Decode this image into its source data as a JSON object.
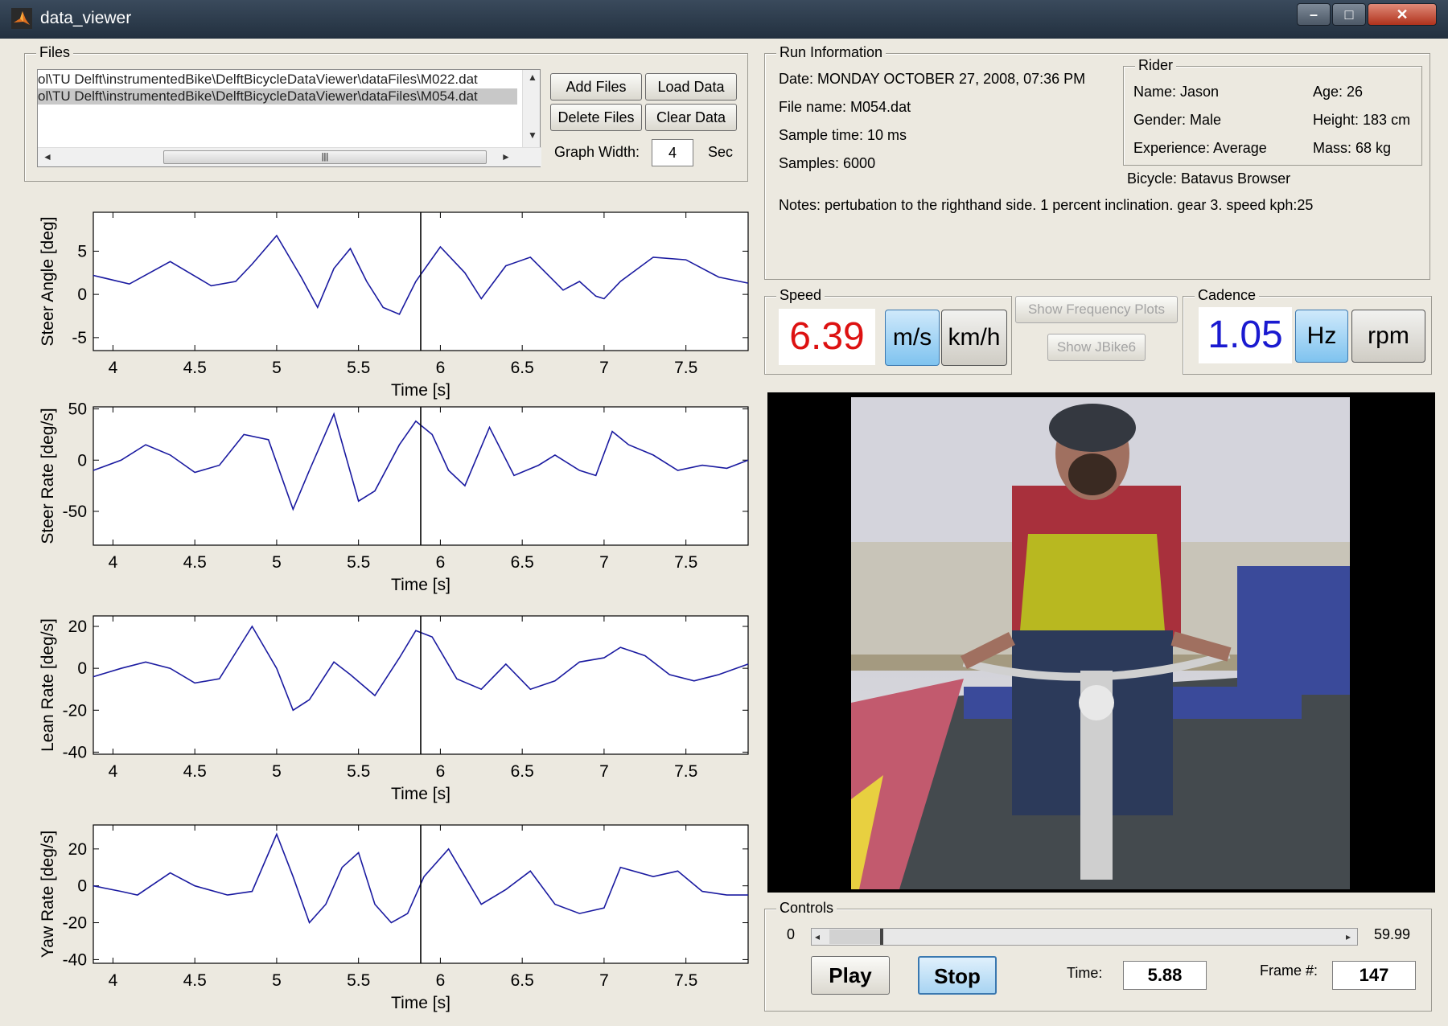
{
  "window": {
    "title": "data_viewer"
  },
  "files": {
    "group_label": "Files",
    "items": [
      "ol\\TU Delft\\instrumentedBike\\DelftBicycleDataViewer\\dataFiles\\M022.dat",
      "ol\\TU Delft\\instrumentedBike\\DelftBicycleDataViewer\\dataFiles\\M054.dat"
    ],
    "selected_index": 1,
    "add_label": "Add Files",
    "load_label": "Load Data",
    "delete_label": "Delete Files",
    "clear_label": "Clear Data",
    "graph_width_label": "Graph Width:",
    "graph_width_value": "4",
    "graph_width_unit": "Sec"
  },
  "run_info": {
    "group_label": "Run Information",
    "date": "Date: MONDAY OCTOBER 27, 2008, 07:36 PM",
    "file_name": "File name: M054.dat",
    "sample_time": "Sample time: 10 ms",
    "samples": "Samples: 6000",
    "notes": "Notes: pertubation to the righthand side.  1 percent inclination. gear 3.  speed kph:25",
    "bicycle": "Bicycle: Batavus Browser",
    "rider": {
      "group_label": "Rider",
      "name": "Name: Jason",
      "age": "Age: 26",
      "gender": "Gender: Male",
      "height": "Height: 183 cm",
      "experience": "Experience: Average",
      "mass": "Mass: 68 kg"
    }
  },
  "speed": {
    "group_label": "Speed",
    "value": "6.39",
    "unit_active": "m/s",
    "unit_other": "km/h",
    "value_color": "#dd1111"
  },
  "mid_buttons": {
    "freq": "Show Frequency Plots",
    "jbike": "Show JBike6"
  },
  "cadence": {
    "group_label": "Cadence",
    "value": "1.05",
    "unit_active": "Hz",
    "unit_other": "rpm",
    "value_color": "#1a1ad0"
  },
  "controls": {
    "group_label": "Controls",
    "slider_min": "0",
    "slider_max": "59.99",
    "slider_fraction": 0.098,
    "play_label": "Play",
    "stop_label": "Stop",
    "time_label": "Time:",
    "time_value": "5.88",
    "frame_label": "Frame #:",
    "frame_value": "147"
  },
  "chart_data": [
    {
      "type": "line",
      "ylabel": "Steer Angle [deg]",
      "xlabel": "Time [s]",
      "xlim": [
        3.88,
        7.88
      ],
      "ylim": [
        -6.5,
        9.5
      ],
      "yticks": [
        -5,
        0,
        5
      ],
      "xticks": [
        4,
        4.5,
        5,
        5.5,
        6,
        6.5,
        7,
        7.5
      ],
      "cursor_x": 5.88,
      "series": [
        {
          "color": "#1a1aa0",
          "x": [
            3.88,
            4.1,
            4.35,
            4.6,
            4.75,
            4.85,
            5.0,
            5.15,
            5.25,
            5.35,
            5.45,
            5.55,
            5.65,
            5.75,
            5.85,
            6.0,
            6.15,
            6.25,
            6.4,
            6.55,
            6.75,
            6.85,
            6.95,
            7.0,
            7.1,
            7.3,
            7.5,
            7.7,
            7.88
          ],
          "y": [
            2.2,
            1.2,
            3.8,
            1.0,
            1.5,
            3.5,
            6.8,
            2.0,
            -1.5,
            3.0,
            5.3,
            1.5,
            -1.5,
            -2.3,
            1.5,
            5.5,
            2.5,
            -0.5,
            3.3,
            4.3,
            0.5,
            1.5,
            -0.2,
            -0.5,
            1.5,
            4.3,
            4.0,
            2.0,
            1.3
          ]
        }
      ]
    },
    {
      "type": "line",
      "ylabel": "Steer Rate [deg/s]",
      "xlabel": "Time [s]",
      "xlim": [
        3.88,
        7.88
      ],
      "ylim": [
        -83,
        52
      ],
      "yticks": [
        -50,
        0,
        50
      ],
      "xticks": [
        4,
        4.5,
        5,
        5.5,
        6,
        6.5,
        7,
        7.5
      ],
      "cursor_x": 5.88,
      "series": [
        {
          "color": "#1a1aa0",
          "x": [
            3.88,
            4.05,
            4.2,
            4.35,
            4.5,
            4.65,
            4.8,
            4.95,
            5.1,
            5.2,
            5.35,
            5.5,
            5.6,
            5.75,
            5.85,
            5.95,
            6.05,
            6.15,
            6.3,
            6.45,
            6.6,
            6.7,
            6.85,
            6.95,
            7.05,
            7.15,
            7.3,
            7.45,
            7.6,
            7.75,
            7.88
          ],
          "y": [
            -10,
            0,
            15,
            5,
            -12,
            -5,
            25,
            20,
            -48,
            -10,
            45,
            -40,
            -30,
            15,
            38,
            25,
            -10,
            -25,
            32,
            -15,
            -5,
            5,
            -10,
            -15,
            28,
            15,
            5,
            -10,
            -5,
            -8,
            0
          ]
        }
      ]
    },
    {
      "type": "line",
      "ylabel": "Lean Rate [deg/s]",
      "xlabel": "Time [s]",
      "xlim": [
        3.88,
        7.88
      ],
      "ylim": [
        -41,
        25
      ],
      "yticks": [
        -40,
        -20,
        0,
        20
      ],
      "xticks": [
        4,
        4.5,
        5,
        5.5,
        6,
        6.5,
        7,
        7.5
      ],
      "cursor_x": 5.88,
      "series": [
        {
          "color": "#1a1aa0",
          "x": [
            3.88,
            4.05,
            4.2,
            4.35,
            4.5,
            4.65,
            4.85,
            5.0,
            5.1,
            5.2,
            5.35,
            5.45,
            5.6,
            5.75,
            5.85,
            5.95,
            6.1,
            6.25,
            6.4,
            6.55,
            6.7,
            6.85,
            7.0,
            7.1,
            7.25,
            7.4,
            7.55,
            7.7,
            7.88
          ],
          "y": [
            -4,
            0,
            3,
            0,
            -7,
            -5,
            20,
            0,
            -20,
            -15,
            3,
            -3,
            -13,
            5,
            18,
            15,
            -5,
            -10,
            2,
            -10,
            -6,
            3,
            5,
            10,
            6,
            -3,
            -6,
            -3,
            2
          ]
        }
      ]
    },
    {
      "type": "line",
      "ylabel": "Yaw Rate [deg/s]",
      "xlabel": "Time [s]",
      "xlim": [
        3.88,
        7.88
      ],
      "ylim": [
        -42,
        33
      ],
      "yticks": [
        -40,
        -20,
        0,
        20
      ],
      "xticks": [
        4,
        4.5,
        5,
        5.5,
        6,
        6.5,
        7,
        7.5
      ],
      "cursor_x": 5.88,
      "series": [
        {
          "color": "#1a1aa0",
          "x": [
            3.88,
            4.05,
            4.15,
            4.35,
            4.5,
            4.7,
            4.85,
            5.0,
            5.1,
            5.2,
            5.3,
            5.4,
            5.5,
            5.6,
            5.7,
            5.8,
            5.9,
            6.05,
            6.15,
            6.25,
            6.4,
            6.55,
            6.7,
            6.85,
            7.0,
            7.1,
            7.3,
            7.45,
            7.6,
            7.75,
            7.88
          ],
          "y": [
            0,
            -3,
            -5,
            7,
            0,
            -5,
            -3,
            28,
            5,
            -20,
            -10,
            10,
            18,
            -10,
            -20,
            -15,
            5,
            20,
            5,
            -10,
            -2,
            8,
            -10,
            -15,
            -12,
            10,
            5,
            8,
            -3,
            -5,
            -5
          ]
        }
      ]
    }
  ]
}
